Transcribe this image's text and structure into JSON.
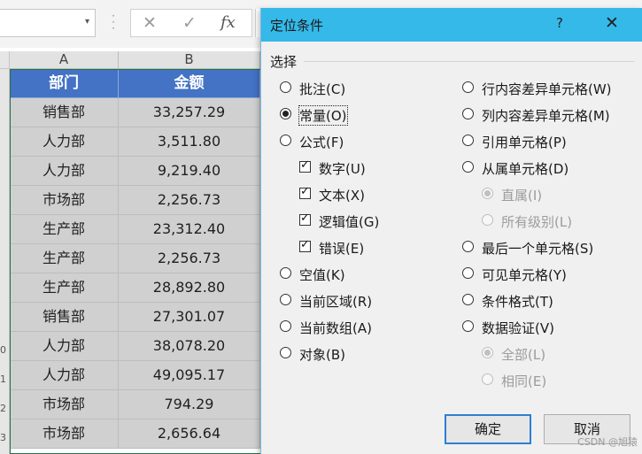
{
  "formula_bar": {
    "dropdown_glyph": "▾",
    "cancel_glyph": "✕",
    "enter_glyph": "✓",
    "fx_label": "fx"
  },
  "sheet": {
    "columns": [
      "A",
      "B"
    ],
    "header": [
      "部门",
      "金额"
    ],
    "rows": [
      {
        "dept": "销售部",
        "amount": "33,257.29"
      },
      {
        "dept": "人力部",
        "amount": "3,511.80"
      },
      {
        "dept": "人力部",
        "amount": "9,219.40"
      },
      {
        "dept": "市场部",
        "amount": "2,256.73"
      },
      {
        "dept": "生产部",
        "amount": "23,312.40"
      },
      {
        "dept": "生产部",
        "amount": "2,256.73"
      },
      {
        "dept": "生产部",
        "amount": "28,892.80"
      },
      {
        "dept": "销售部",
        "amount": "27,301.07"
      },
      {
        "dept": "人力部",
        "amount": "38,078.20"
      },
      {
        "dept": "人力部",
        "amount": "49,095.17"
      },
      {
        "dept": "市场部",
        "amount": "794.29"
      },
      {
        "dept": "市场部",
        "amount": "2,656.64"
      }
    ],
    "row_number_fragments": [
      "0",
      "1",
      "2",
      "3"
    ],
    "header_color": "#4472c4",
    "selected_cell_color": "#d0d0d0"
  },
  "dialog": {
    "title": "定位条件",
    "help": "?",
    "close": "✕",
    "group_label": "选择",
    "left_options": [
      {
        "label": "批注(C)",
        "type": "radio",
        "checked": false
      },
      {
        "label": "常量(O)",
        "type": "radio",
        "checked": true
      },
      {
        "label": "公式(F)",
        "type": "radio",
        "checked": false
      },
      {
        "label": "数字(U)",
        "type": "checkbox",
        "checked": true
      },
      {
        "label": "文本(X)",
        "type": "checkbox",
        "checked": true
      },
      {
        "label": "逻辑值(G)",
        "type": "checkbox",
        "checked": true
      },
      {
        "label": "错误(E)",
        "type": "checkbox",
        "checked": true
      },
      {
        "label": "空值(K)",
        "type": "radio",
        "checked": false
      },
      {
        "label": "当前区域(R)",
        "type": "radio",
        "checked": false
      },
      {
        "label": "当前数组(A)",
        "type": "radio",
        "checked": false
      },
      {
        "label": "对象(B)",
        "type": "radio",
        "checked": false
      }
    ],
    "right_options": [
      {
        "label": "行内容差异单元格(W)",
        "type": "radio",
        "checked": false,
        "disabled": false
      },
      {
        "label": "列内容差异单元格(M)",
        "type": "radio",
        "checked": false,
        "disabled": false
      },
      {
        "label": "引用单元格(P)",
        "type": "radio",
        "checked": false,
        "disabled": false
      },
      {
        "label": "从属单元格(D)",
        "type": "radio",
        "checked": false,
        "disabled": false
      },
      {
        "label": "直属(I)",
        "type": "radio",
        "checked": true,
        "disabled": true
      },
      {
        "label": "所有级别(L)",
        "type": "radio",
        "checked": false,
        "disabled": true
      },
      {
        "label": "最后一个单元格(S)",
        "type": "radio",
        "checked": false,
        "disabled": false
      },
      {
        "label": "可见单元格(Y)",
        "type": "radio",
        "checked": false,
        "disabled": false
      },
      {
        "label": "条件格式(T)",
        "type": "radio",
        "checked": false,
        "disabled": false
      },
      {
        "label": "数据验证(V)",
        "type": "radio",
        "checked": false,
        "disabled": false
      },
      {
        "label": "全部(L)",
        "type": "radio",
        "checked": true,
        "disabled": true
      },
      {
        "label": "相同(E)",
        "type": "radio",
        "checked": false,
        "disabled": true
      }
    ],
    "ok_label": "确定",
    "cancel_label": "取消",
    "titlebar_color": "#35b9e9"
  },
  "watermark": "CSDN @旭猿"
}
